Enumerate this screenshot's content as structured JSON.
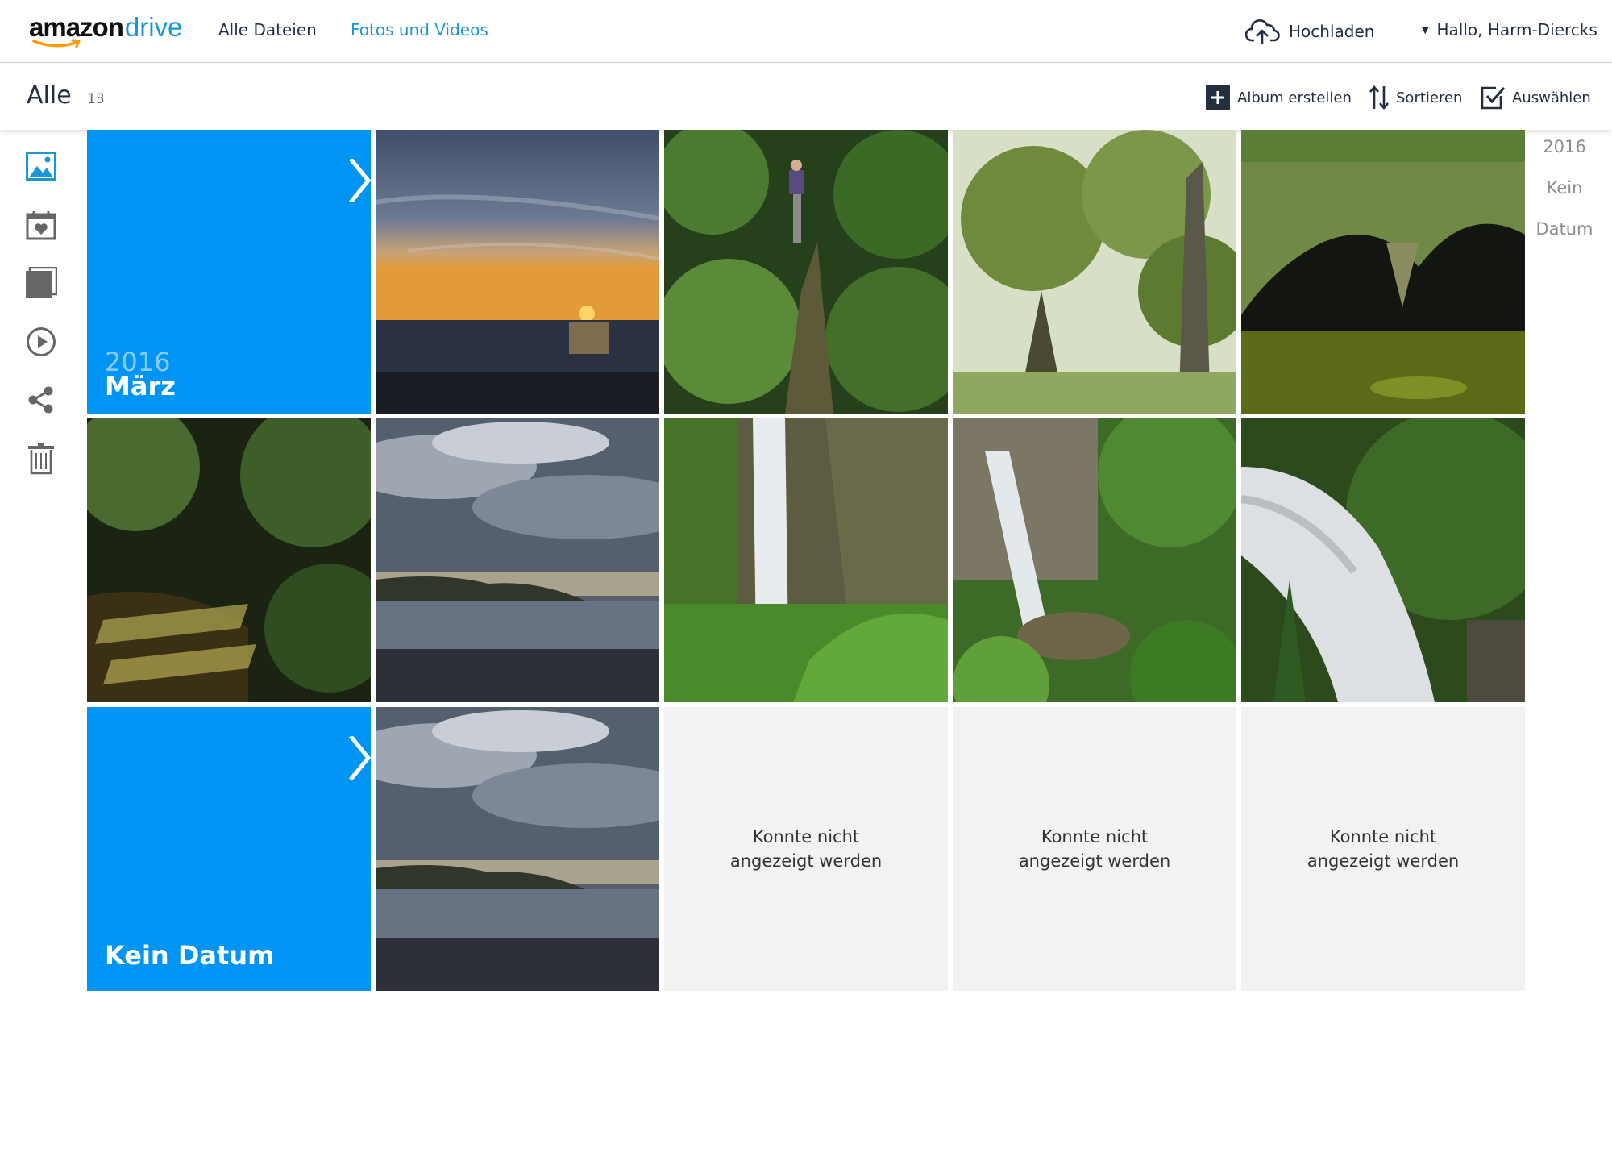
{
  "brand": {
    "part1": "amazon",
    "part2": "drive"
  },
  "nav": [
    {
      "label": "Alle Dateien",
      "active": false
    },
    {
      "label": "Fotos und Videos",
      "active": true
    }
  ],
  "header": {
    "upload_label": "Hochladen",
    "user_greeting": "Hallo, Harm-Diercks"
  },
  "toolbar": {
    "title": "Alle",
    "count": "13",
    "create_album_label": "Album erstellen",
    "sort_label": "Sortieren",
    "select_label": "Auswählen"
  },
  "sidebar": {
    "items": [
      {
        "icon": "photos-icon",
        "active": true
      },
      {
        "icon": "calendar-icon",
        "active": false
      },
      {
        "icon": "albums-icon",
        "active": false
      },
      {
        "icon": "video-icon",
        "active": false
      },
      {
        "icon": "share-icon",
        "active": false
      },
      {
        "icon": "trash-icon",
        "active": false
      }
    ]
  },
  "groups": [
    {
      "year": "2016",
      "month": "März",
      "photos": [
        "sunset",
        "forest-trail",
        "mossy-trees",
        "cave",
        "jungle-stream",
        "cloudy-coast",
        "waterfall-cliff",
        "waterfall-valley",
        "waterfall-close"
      ]
    },
    {
      "label": "Kein Datum",
      "photos": [
        "cloudy-coast"
      ],
      "unavailable_count": 3
    }
  ],
  "unavailable": {
    "line1": "Konnte nicht",
    "line2": "angezeigt werden"
  },
  "timeline": [
    "2016",
    "Kein",
    "Datum"
  ],
  "colors": {
    "accent": "#1a98d5",
    "date_tile": "#0094f5",
    "placeholder": "#f2f2f2"
  }
}
